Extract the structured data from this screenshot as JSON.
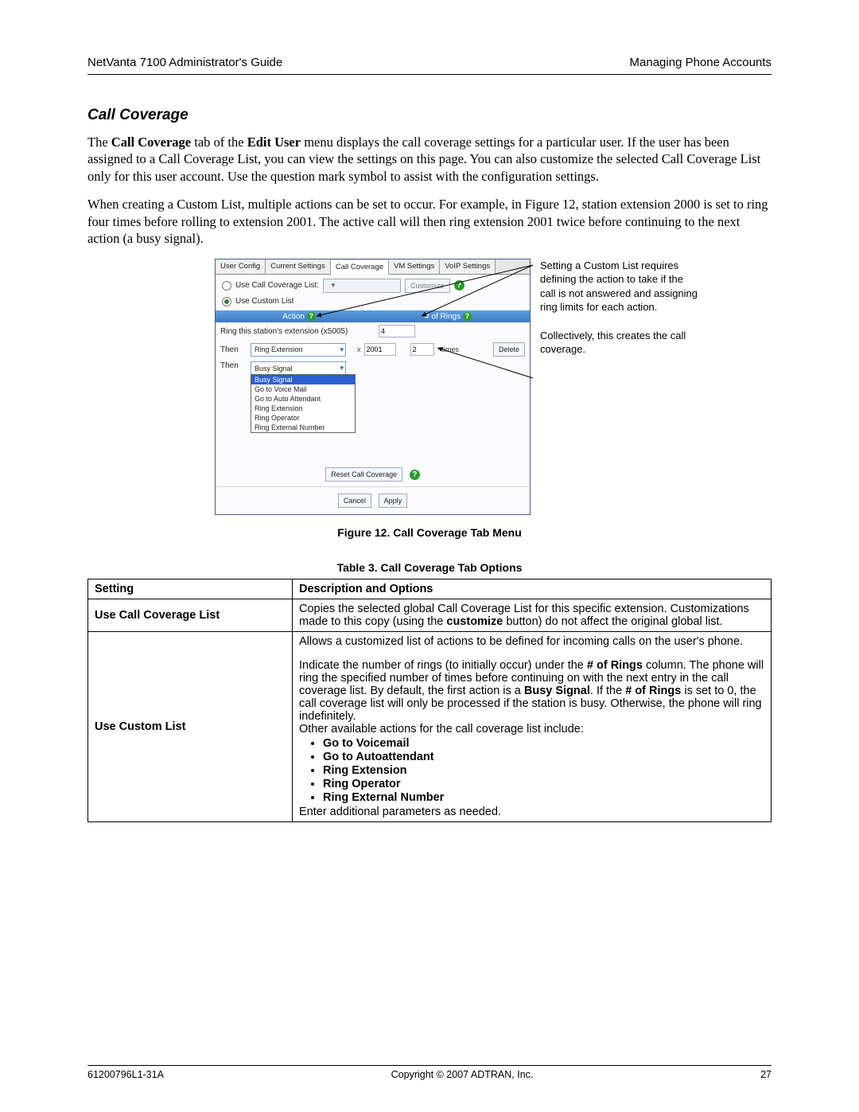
{
  "header": {
    "left": "NetVanta 7100 Administrator's Guide",
    "right": "Managing Phone Accounts"
  },
  "section_title": "Call Coverage",
  "para1_parts": {
    "p1": "The ",
    "b1": "Call Coverage",
    "p2": " tab of the ",
    "b2": "Edit User",
    "p3": " menu displays the call coverage settings for a particular user. If the user has been assigned to a Call Coverage List, you can view the settings on this page. You can also customize the selected Call Coverage List only for this user account. Use the question mark symbol to assist with the configuration settings."
  },
  "para2": "When creating a Custom List, multiple actions can be set to occur. For example, in Figure 12, station extension 2000 is set to ring four times before rolling to extension 2001. The active call will then ring extension 2001 twice before continuing to the next action (a busy signal).",
  "annotations": {
    "a1": "Setting a Custom List requires defining the action to take if the call is not answered and assigning ring limits for each action.",
    "a2": "Collectively, this creates the call coverage."
  },
  "ui": {
    "tabs": [
      "User Config",
      "Current Settings",
      "Call Coverage",
      "VM Settings",
      "VoIP Settings"
    ],
    "active_tab": "Call Coverage",
    "opt1_label": "Use Call Coverage List:",
    "opt2_label": "Use Custom List",
    "customize_btn": "Customize",
    "hdr_action": "Action",
    "hdr_rings": "# of Rings",
    "row0_label": "Ring this station's extension (x5005)",
    "row0_rings": "4",
    "row1_then": "Then",
    "row1_action": "Ring Extension",
    "row1_ext_prefix": "x",
    "row1_ext": "2001",
    "row1_rings": "2",
    "row1_times": "times",
    "row1_delete": "Delete",
    "row2_then": "Then",
    "row2_action": "Busy Signal",
    "dropdown": [
      "Busy Signal",
      "Go to Voice Mail",
      "Go to Auto Attendant",
      "Ring Extension",
      "Ring Operator",
      "Ring External Number"
    ],
    "reset_btn": "Reset Call Coverage",
    "cancel_btn": "Cancel",
    "apply_btn": "Apply"
  },
  "figure_caption": "Figure 12.  Call Coverage Tab Menu",
  "table_caption": "Table 3.  Call Coverage Tab Options",
  "table": {
    "h1": "Setting",
    "h2": "Description and Options",
    "r1_setting": "Use Call Coverage List",
    "r1_desc_a": "Copies the selected global Call Coverage List for this specific extension. Customizations made to this copy (using the ",
    "r1_desc_b": "customize",
    "r1_desc_c": " button) do not affect the original global list.",
    "r2_setting": "Use Custom List",
    "r2_p1": "Allows a customized list of actions to be defined for incoming calls on the user's phone.",
    "r2_p2a": "Indicate the number of rings (to initially occur) under the ",
    "r2_p2b": "# of Rings",
    "r2_p2c": " column.  The phone will ring the specified number of times before continuing on with the next entry in the call coverage list. By default, the first action is a ",
    "r2_p2d": "Busy Signal",
    "r2_p2e": ". If the ",
    "r2_p2f": "# of Rings",
    "r2_p2g": " is set to 0, the call coverage list will only be processed if the station is busy. Otherwise, the phone will ring indefinitely.",
    "r2_p3": "Other available actions for the call coverage list include:",
    "r2_bullets": [
      "Go to Voicemail",
      "Go to Autoattendant",
      "Ring Extension",
      "Ring Operator",
      "Ring External Number"
    ],
    "r2_p4": "Enter additional parameters as needed."
  },
  "footer": {
    "left": "61200796L1-31A",
    "center": "Copyright © 2007 ADTRAN, Inc.",
    "right": "27"
  }
}
